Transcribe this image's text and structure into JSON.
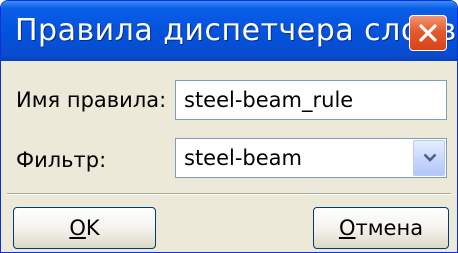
{
  "window": {
    "title": "Правила диспетчера слоев",
    "close_icon": "close-icon"
  },
  "form": {
    "name_label": "Имя правила:",
    "name_value": "steel-beam_rule",
    "filter_label": "Фильтр:",
    "filter_value": "steel-beam",
    "filter_arrow_icon": "chevron-down-icon"
  },
  "buttons": {
    "ok_mnemonic": "O",
    "ok_rest": "K",
    "cancel_mnemonic": "О",
    "cancel_rest": "тмена"
  },
  "colors": {
    "titlebar": "#0555e0",
    "close_button": "#e35b2c",
    "dialog_background": "#ece9d8",
    "input_border": "#7f9db9"
  }
}
